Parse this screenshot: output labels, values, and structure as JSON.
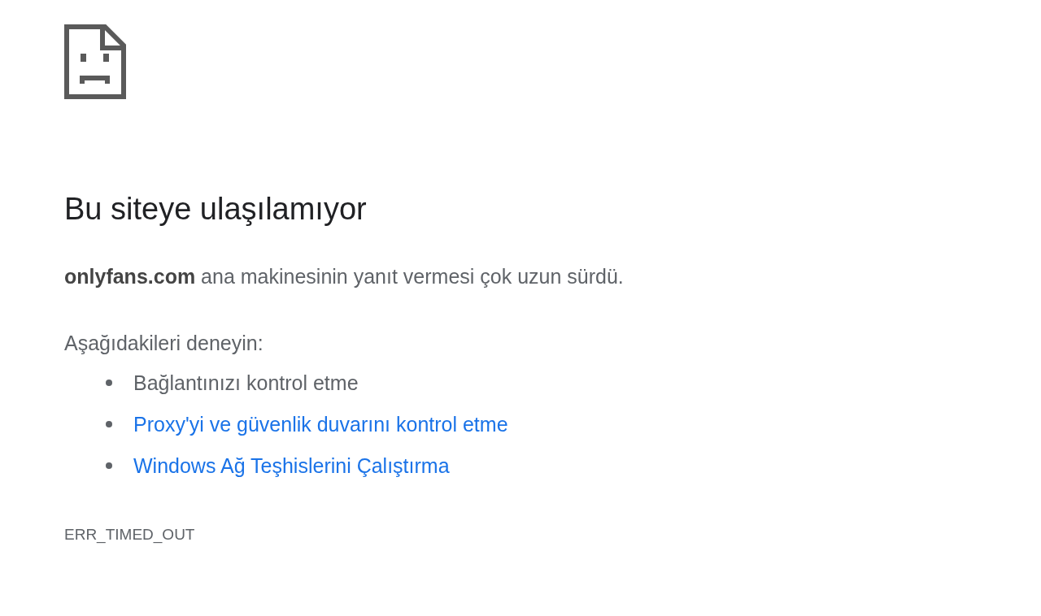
{
  "heading": "Bu siteye ulaşılamıyor",
  "summary": "**onlyfans.com** ana makinesinin yanıt vermesi çok uzun sürdü.",
  "suggestions_title": "Aşağıdakileri deneyin:",
  "suggestions": [
    {
      "kind": "text",
      "label": "Bağlantınızı kontrol etme"
    },
    {
      "kind": "link",
      "label": "Proxy'yi ve güvenlik duvarını kontrol etme"
    },
    {
      "kind": "link",
      "label": "Windows Ağ Teşhislerini Çalıştırma"
    }
  ],
  "error_code": "ERR_TIMED_OUT"
}
